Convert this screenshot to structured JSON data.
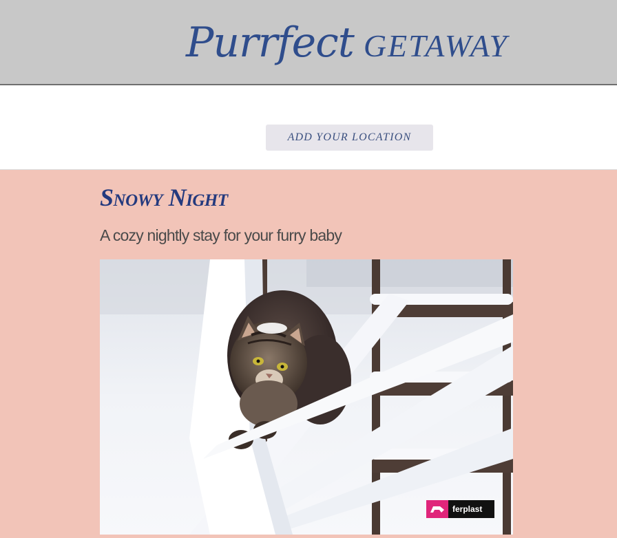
{
  "header": {
    "brand_script": "Purrfect",
    "brand_caps": "GETAWAY"
  },
  "location": {
    "button_label": "ADD YOUR LOCATION"
  },
  "listing": {
    "title": "Snowy Night",
    "subtitle": "A cozy nightly stay for your furry baby",
    "photo": {
      "subject": "cat-on-snowy-fence",
      "watermark": "ferplast"
    }
  },
  "colors": {
    "header_bg": "#c8c8c8",
    "brand_blue": "#2f4d8c",
    "content_bg": "#f2c4b8",
    "title_blue": "#243a7e",
    "button_bg": "#e7e5eb"
  }
}
